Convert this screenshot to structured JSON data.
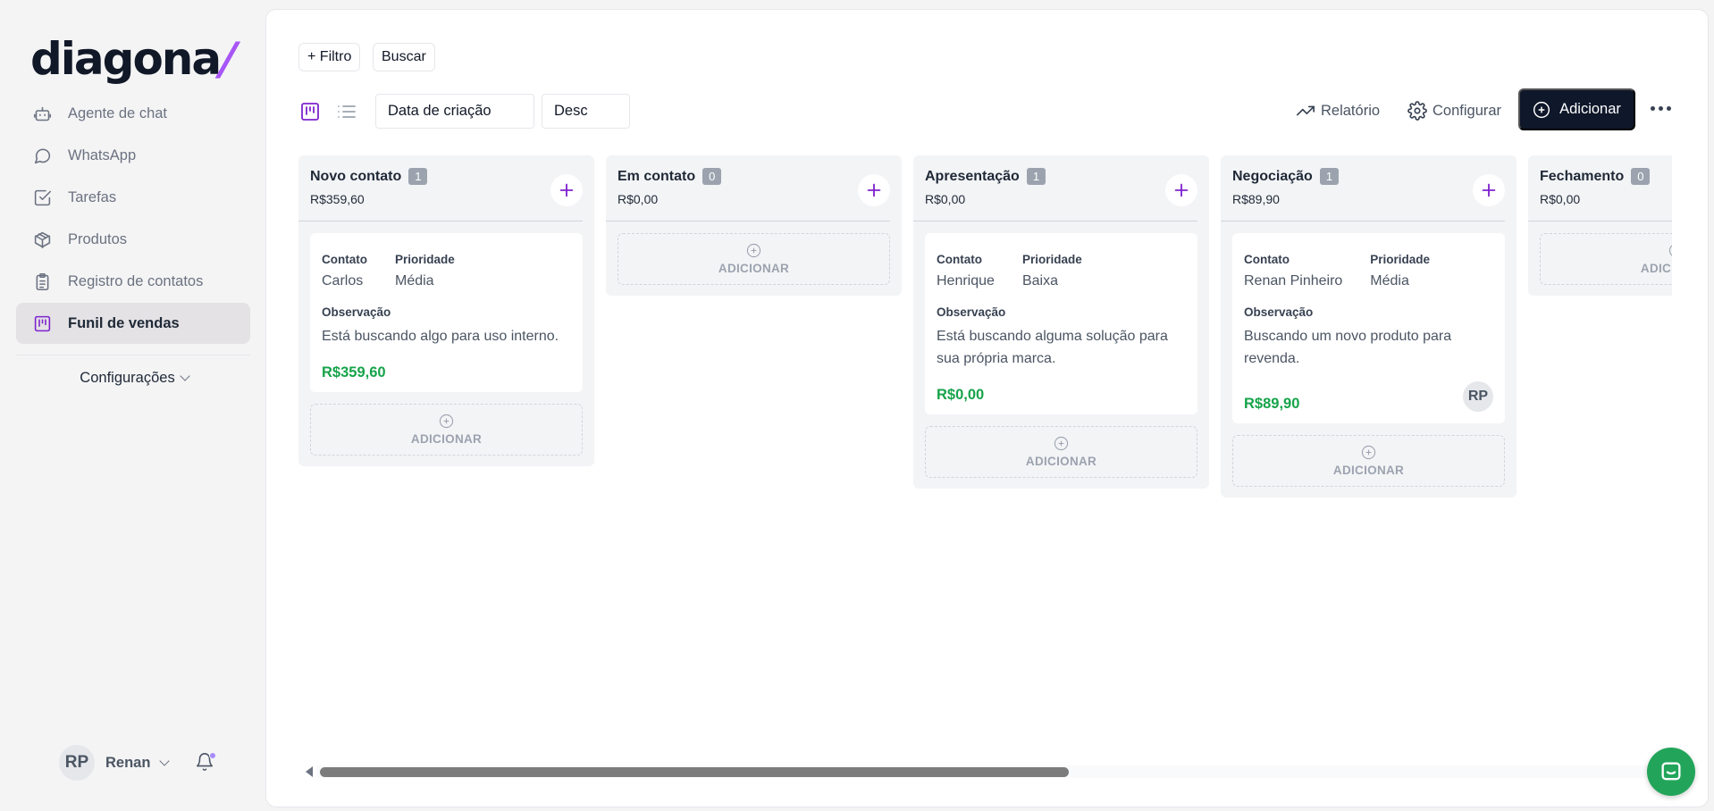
{
  "brand": {
    "logo_text": "diagona",
    "logo_slash": "/"
  },
  "sidebar": {
    "items": [
      {
        "label": "Agente de chat",
        "icon": "bot-icon",
        "active": false
      },
      {
        "label": "WhatsApp",
        "icon": "chat-bubble-icon",
        "active": false
      },
      {
        "label": "Tarefas",
        "icon": "checkbox-icon",
        "active": false
      },
      {
        "label": "Produtos",
        "icon": "package-icon",
        "active": false
      },
      {
        "label": "Registro de contatos",
        "icon": "clipboard-icon",
        "active": false
      },
      {
        "label": "Funil de vendas",
        "icon": "kanban-icon",
        "active": true
      }
    ],
    "settings_label": "Configurações",
    "user": {
      "initials": "RP",
      "name": "Renan"
    }
  },
  "toolbar": {
    "filter_label": "+ Filtro",
    "search_label": "Buscar",
    "sort_field": "Data de criação",
    "sort_order": "Desc",
    "report_label": "Relatório",
    "configure_label": "Configurar",
    "add_label": "Adicionar"
  },
  "board": {
    "add_zone_label": "ADICIONAR",
    "columns": [
      {
        "title": "Novo contato",
        "count": "1",
        "total": "R$359,60",
        "cards": [
          {
            "contact_label": "Contato",
            "contact": "Carlos",
            "priority_label": "Prioridade",
            "priority": "Média",
            "obs_label": "Observação",
            "obs": "Está buscando algo para uso interno.",
            "value": "R$359,60",
            "owner": ""
          }
        ]
      },
      {
        "title": "Em contato",
        "count": "0",
        "total": "R$0,00",
        "cards": []
      },
      {
        "title": "Apresentação",
        "count": "1",
        "total": "R$0,00",
        "cards": [
          {
            "contact_label": "Contato",
            "contact": "Henrique",
            "priority_label": "Prioridade",
            "priority": "Baixa",
            "obs_label": "Observação",
            "obs": "Está buscando alguma solução para sua própria marca.",
            "value": "R$0,00",
            "owner": ""
          }
        ]
      },
      {
        "title": "Negociação",
        "count": "1",
        "total": "R$89,90",
        "cards": [
          {
            "contact_label": "Contato",
            "contact": "Renan Pinheiro",
            "priority_label": "Prioridade",
            "priority": "Média",
            "obs_label": "Observação",
            "obs": "Buscando um novo produto para revenda.",
            "value": "R$89,90",
            "owner": "RP"
          }
        ]
      },
      {
        "title": "Fechamento",
        "count": "0",
        "total": "R$0,00",
        "cards": []
      }
    ]
  },
  "colors": {
    "accent": "#7e22ce",
    "primary_button": "#0f172a",
    "value_green": "#16a34a",
    "chat_green": "#22a55a"
  }
}
